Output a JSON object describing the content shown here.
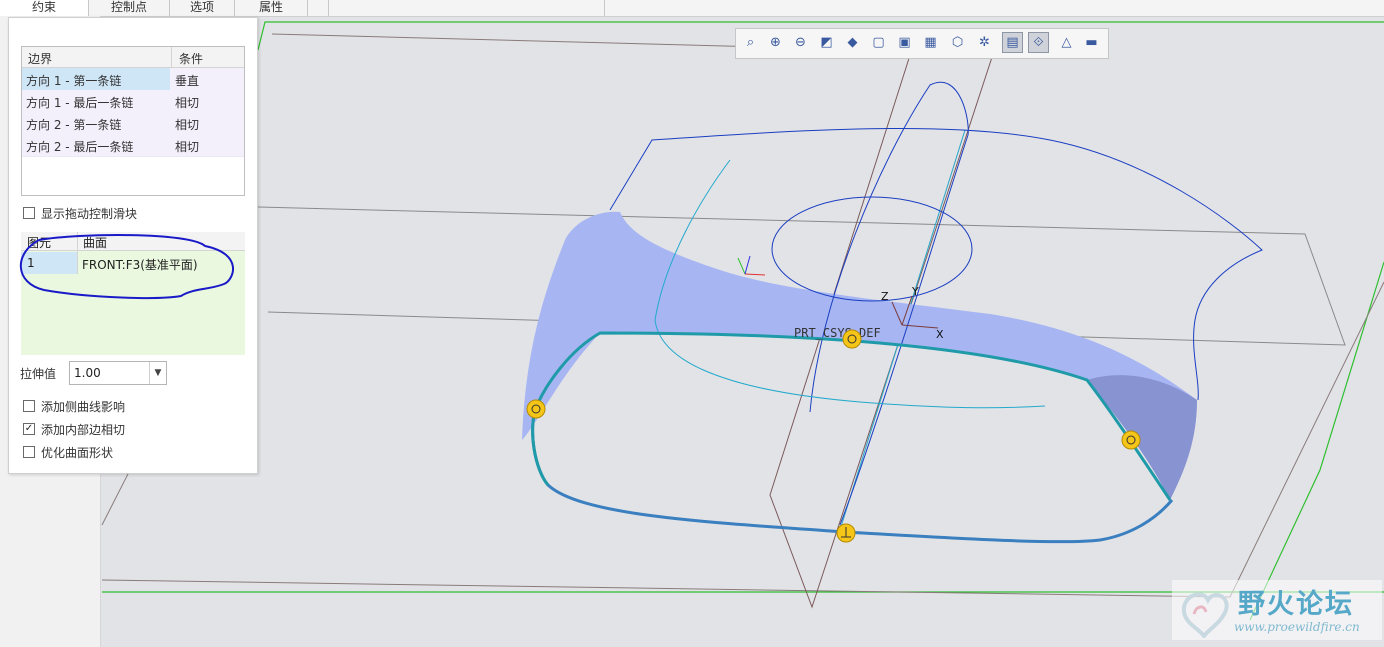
{
  "tabs": [
    "约束",
    "控制点",
    "选项",
    "属性"
  ],
  "boundary_table": {
    "headers": [
      "边界",
      "条件"
    ],
    "rows": [
      {
        "boundary": "方向 1 - 第一条链",
        "condition": "垂直",
        "selected": true
      },
      {
        "boundary": "方向 1 - 最后一条链",
        "condition": "相切",
        "selected": false
      },
      {
        "boundary": "方向 2 - 第一条链",
        "condition": "相切",
        "selected": false
      },
      {
        "boundary": "方向 2 - 最后一条链",
        "condition": "相切",
        "selected": false
      }
    ]
  },
  "show_drag_handles": {
    "label": "显示拖动控制滑块",
    "checked": false
  },
  "surface_table": {
    "headers": [
      "图元",
      "曲面"
    ],
    "rows": [
      {
        "element": "1",
        "surface": "FRONT:F3(基准平面)"
      }
    ]
  },
  "stretch": {
    "label": "拉伸值",
    "value": "1.00"
  },
  "options": [
    {
      "label": "添加侧曲线影响",
      "checked": false
    },
    {
      "label": "添加内部边相切",
      "checked": true
    },
    {
      "label": "优化曲面形状",
      "checked": false
    }
  ],
  "toolbar_icons": [
    "refit-icon",
    "zoom-in-icon",
    "zoom-out-icon",
    "repaint-icon",
    "shading-icon",
    "display-style-icon",
    "saved-views-icon",
    "view-manager-icon",
    "perspective-icon",
    "datum-display-icon",
    "spin-center-icon",
    "annotation-display-icon",
    "simulation-display-icon",
    "appearance-icon"
  ],
  "toolbar_active": [
    10,
    11
  ],
  "csys_label": "PRT_CSYS_DEF",
  "axis_labels": {
    "x": "X",
    "y": "Y",
    "z": "Z"
  },
  "watermark": {
    "title": "野火论坛",
    "url": "www.proewildfire.cn"
  },
  "colors": {
    "surface": "#a7b6f2",
    "boundary": "#1f9aa8",
    "datum": "#2fbf2f",
    "annotation": "#1a1ac8"
  }
}
